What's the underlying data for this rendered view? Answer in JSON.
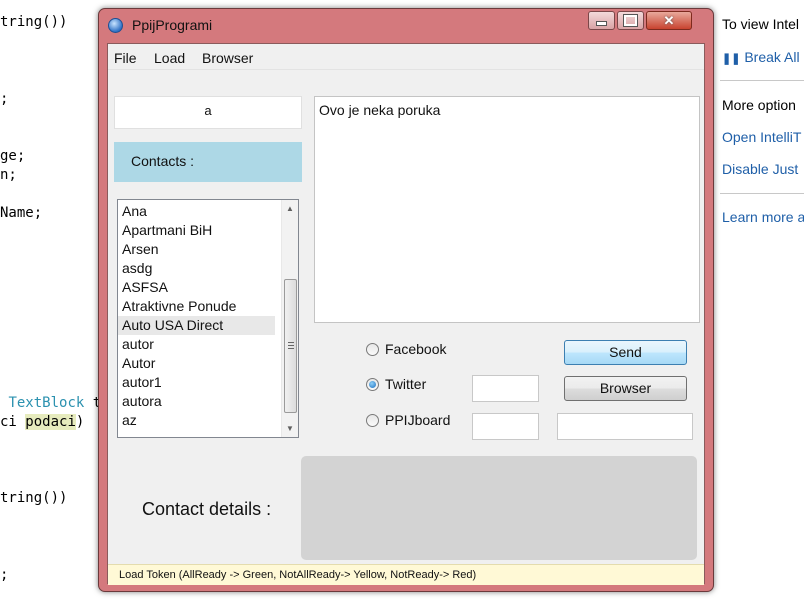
{
  "background_editor": {
    "lines": [
      "tring())",
      ";",
      "ge;",
      "n;",
      "Name;",
      "ci podaci)",
      "tring())",
      ";"
    ],
    "textblock_keyword": "TextBlock",
    "textblock_tail": "t",
    "highlight_word": "podaci"
  },
  "help_pane": {
    "heading": "To view Intel",
    "break_all": "Break All",
    "more_options": "More option",
    "open_intellitrace": "Open IntelliT",
    "disable_just": "Disable Just",
    "learn_more": "Learn more a"
  },
  "window": {
    "title": "PpijProgrami",
    "menu": [
      "File",
      "Load",
      "Browser"
    ],
    "name_value": "a",
    "contacts_label": "Contacts :",
    "contacts": [
      "Ana",
      "Apartmani BiH",
      "Arsen",
      "asdg",
      "ASFSA",
      "Atraktivne Ponude",
      "Auto USA Direct",
      "autor",
      "Autor",
      "autor1",
      "autora",
      "az"
    ],
    "selected_contact": "Auto USA Direct",
    "message": "Ovo je neka poruka",
    "radios": [
      {
        "label": "Facebook",
        "checked": false
      },
      {
        "label": "Twitter",
        "checked": true
      },
      {
        "label": "PPIJboard",
        "checked": false
      }
    ],
    "send_label": "Send",
    "browser_label": "Browser",
    "contact_details_label": "Contact details :",
    "status": "Load Token (AllReady -> Green, NotAllReady-> Yellow, NotReady-> Red)"
  },
  "colors": {
    "window_frame": "#d4797d",
    "contacts_label_bg": "#add8e6",
    "details_panel_bg": "#d3d3d3",
    "status_bg": "#fff9d6",
    "link": "#1f5fa8"
  },
  "icons": {
    "app": "app-icon",
    "break_all": "pause-icon",
    "scroll_up": "scroll-up-arrow-icon",
    "scroll_down": "scroll-down-arrow-icon"
  }
}
